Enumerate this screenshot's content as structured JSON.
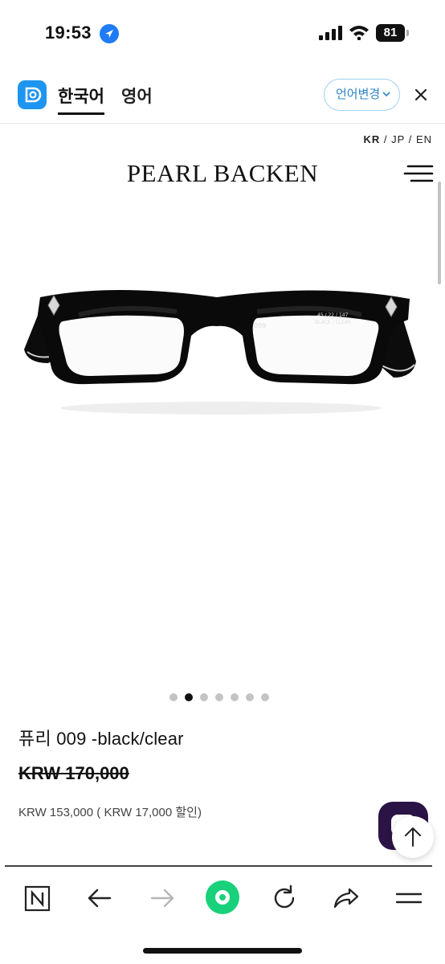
{
  "status_bar": {
    "time": "19:53",
    "battery": "81"
  },
  "translator_bar": {
    "tab_korean": "한국어",
    "tab_english": "영어",
    "language_change": "언어변경"
  },
  "site": {
    "language_switch": {
      "kr": "KR",
      "jp": "JP",
      "en": "EN",
      "separator": "/"
    },
    "brand": "PEARL BACKEN"
  },
  "product": {
    "name": "퓨리 009 -black/clear",
    "original_price": "KRW 170,000",
    "sale_price": "KRW 153,000 ( KRW 17,000 할인)",
    "image_count": 7,
    "active_image": 2,
    "frame_print_1": "009",
    "frame_print_2": "45 / 22 / 147",
    "frame_print_3": "BLACK / CLEAR"
  },
  "colors": {
    "accent_green": "#19d17a",
    "translator_blue": "#1e95f0",
    "chat_purple": "#2a1445",
    "location_blue": "#1f7cf6"
  },
  "icons": {
    "toolbar": [
      "n-icon",
      "back-arrow-icon",
      "forward-arrow-icon",
      "home-icon",
      "reload-icon",
      "share-icon",
      "menu-icon"
    ]
  }
}
